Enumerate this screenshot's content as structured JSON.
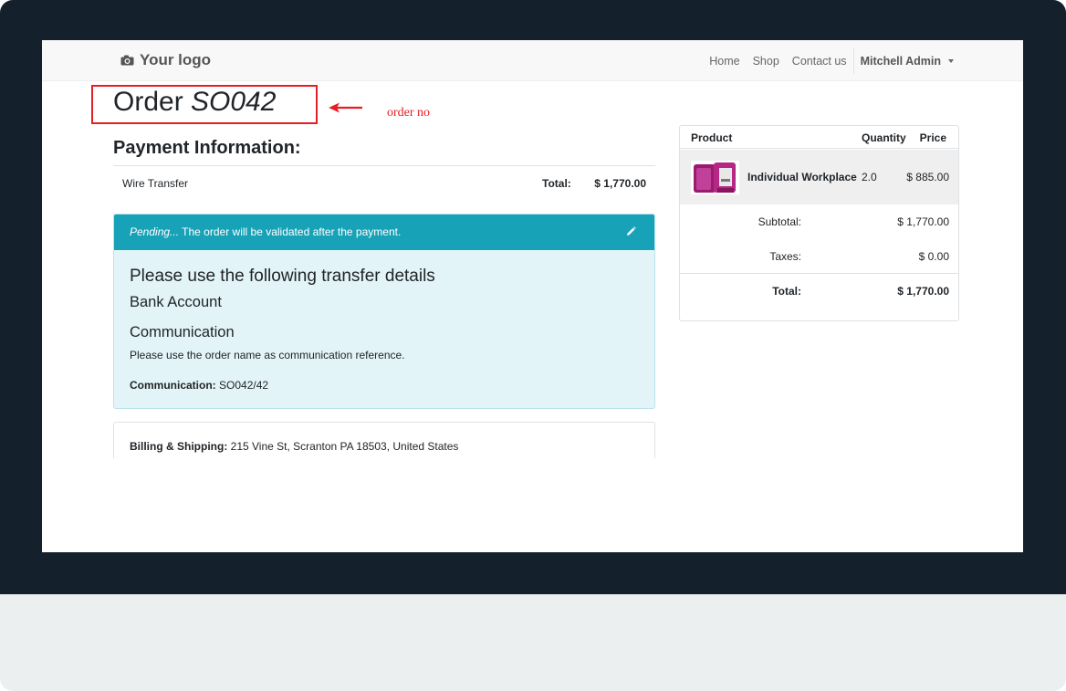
{
  "navbar": {
    "logo_text": "Your logo",
    "links": [
      "Home",
      "Shop",
      "Contact us"
    ],
    "user": "Mitchell Admin"
  },
  "order": {
    "title_prefix": "Order",
    "number": "SO042"
  },
  "annotation": {
    "label": "order no",
    "color": "#e61e24"
  },
  "payment": {
    "heading": "Payment Information:",
    "method": "Wire Transfer",
    "total_label": "Total:",
    "total_value": "$ 1,770.00"
  },
  "alert": {
    "status_word": "Pending...",
    "status_text": " The order will be validated after the payment.",
    "heading": "Please use the following transfer details",
    "bank_account": "Bank Account",
    "communication_heading": "Communication",
    "instruction": "Please use the order name as communication reference.",
    "communication_label": "Communication:",
    "communication_value": " SO042/42",
    "accent_color": "#17a2b8"
  },
  "billing": {
    "label": "Billing & Shipping:",
    "address": " 215 Vine St, Scranton PA 18503, United States"
  },
  "cart": {
    "headers": {
      "product": "Product",
      "quantity": "Quantity",
      "price": "Price"
    },
    "lines": [
      {
        "name": "Individual Workplace",
        "quantity": "2.0",
        "price": "$ 885.00",
        "image": "purple-office-booth"
      }
    ],
    "subtotal_label": "Subtotal:",
    "subtotal_value": "$ 1,770.00",
    "taxes_label": "Taxes:",
    "taxes_value": "$ 0.00",
    "total_label": "Total:",
    "total_value": "$ 1,770.00"
  }
}
